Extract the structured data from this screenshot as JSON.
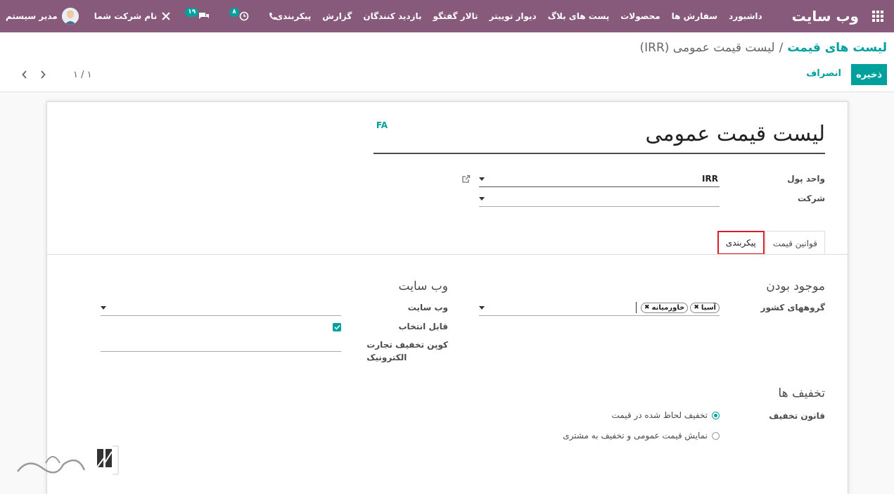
{
  "navbar": {
    "brand": "وب سایت",
    "menu": [
      "داشبورد",
      "سفارش ها",
      "محصولات",
      "پست های بلاگ",
      "دیوار توییتر",
      "تالار گفتگو",
      "بازدید کنندگان",
      "گزارش",
      "پیکربندی"
    ],
    "company": "نام شرکت شما",
    "user": "مدیر سیستم",
    "messages_count": "۱۹",
    "activities_count": "۸"
  },
  "breadcrumb": {
    "parent": "لیست های قیمت",
    "separator": "/",
    "current": "لیست قیمت عمومی (IRR)"
  },
  "buttons": {
    "save": "ذخیره",
    "discard": "انصراف"
  },
  "pager": {
    "counter": "۱ / ۱"
  },
  "form": {
    "lang": "FA",
    "name": "لیست قیمت عمومی",
    "currency_label": "واحد پول",
    "currency_value": "IRR",
    "company_label": "شرکت",
    "company_value": ""
  },
  "tabs": [
    "قوانین قیمت",
    "پیکربندی"
  ],
  "availability": {
    "title": "موجود بودن",
    "country_groups_label": "گروههای کشور",
    "country_groups": [
      "آسیا",
      "خاورمیانه"
    ]
  },
  "website": {
    "title": "وب سایت",
    "website_label": "وب سایت",
    "website_value": "",
    "selectable_label": "قابل انتخاب",
    "selectable": true,
    "coupon_label_line1": "کوپن تخفیف تجارت",
    "coupon_label_line2": "الکترونیک",
    "coupon_value": ""
  },
  "discounts": {
    "title": "تخفیف ها",
    "policy_label": "قانون تخفیف",
    "options": [
      "تخفیف لحاظ شده در قیمت",
      "نمایش قیمت عمومی و تخفیف به مشتری"
    ],
    "selected_index": 0
  },
  "colors": {
    "navbar": "#875a7b",
    "primary": "#00a09d",
    "highlight": "#d9202a"
  },
  "icons": [
    "apps-grid-icon",
    "phone-icon",
    "clock-icon",
    "chat-icon",
    "tools-icon",
    "external-link-icon",
    "check-icon",
    "chevron-left-icon",
    "chevron-right-icon"
  ]
}
